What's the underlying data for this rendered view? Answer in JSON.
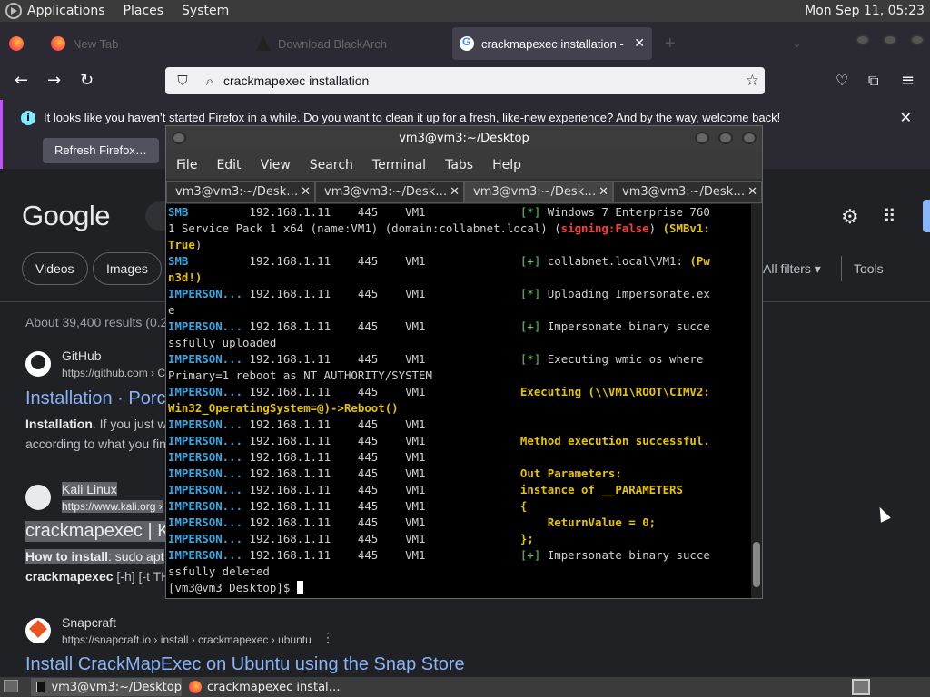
{
  "panel": {
    "menu": [
      "Applications",
      "Places",
      "System"
    ],
    "clock": "Mon Sep 11, 05:23"
  },
  "browser": {
    "tabs": [
      {
        "label": "New Tab",
        "icon": "firefox-icon"
      },
      {
        "label": "Download BlackArch",
        "icon": "blackarch-icon"
      },
      {
        "label": "crackmapexec installation -",
        "icon": "google-icon"
      }
    ],
    "url": "crackmapexec installation",
    "notification": {
      "message": "It looks like you haven’t started Firefox in a while. Do you want to clean it up for a fresh, like-new experience? And by the way, welcome back!",
      "button": "Refresh Firefox…"
    }
  },
  "google": {
    "logo": "Google",
    "chips": [
      "Videos",
      "Images"
    ],
    "all_filters": "All filters",
    "tools": "Tools",
    "results_count": "About 39,400 results (0.2",
    "results": [
      {
        "site": "GitHub",
        "url": "https://github.com › C",
        "title": "Installation · Porc",
        "snippet1_bold": "Installation",
        "snippet1": ". If you just w",
        "snippet2": "according to what you fin"
      },
      {
        "site": "Kali Linux",
        "url": "https://www.kali.org ›",
        "title": "crackmapexec | K",
        "snippet1_bold": "How to install",
        "snippet1": ": sudo apt",
        "snippet2_bold": "crackmapexec",
        "snippet2": " [-h] [-t TH"
      },
      {
        "site": "Snapcraft",
        "url": "https://snapcraft.io › install › crackmapexec › ubuntu",
        "title": "Install CrackMapExec on Ubuntu using the Snap Store"
      }
    ]
  },
  "terminal": {
    "title": "vm3@vm3:~/Desktop",
    "menu": [
      "File",
      "Edit",
      "View",
      "Search",
      "Terminal",
      "Tabs",
      "Help"
    ],
    "tabs": [
      "vm3@vm3:~/Desk…",
      "vm3@vm3:~/Desk…",
      "vm3@vm3:~/Desk…",
      "vm3@vm3:~/Desk…"
    ],
    "prompt": "[vm3@vm3 Desktop]$ "
  },
  "taskbar": {
    "items": [
      "vm3@vm3:~/Desktop",
      "crackmapexec instal…"
    ]
  },
  "colors": {
    "accent": "#c650ff",
    "link": "#8ab4f8",
    "term_cyan": "#3aa6e0",
    "term_green": "#5fcf5f",
    "term_yellow": "#e5c400",
    "term_red": "#ff3b3b"
  }
}
